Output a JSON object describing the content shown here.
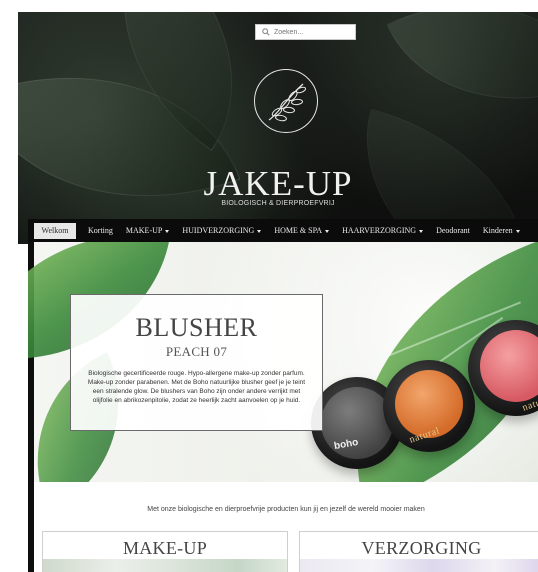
{
  "header": {
    "search": {
      "placeholder": "Zoeken..."
    },
    "brand": {
      "name": "JAKE-UP",
      "tagline": "BIOLOGISCH & DIERPROEFVRIJ"
    }
  },
  "nav": {
    "items": [
      {
        "label": "Welkom",
        "active": true,
        "has_dropdown": false
      },
      {
        "label": "Korting",
        "active": false,
        "has_dropdown": false
      },
      {
        "label": "MAKE-UP",
        "active": false,
        "has_dropdown": true
      },
      {
        "label": "HUIDVERZORGING",
        "active": false,
        "has_dropdown": true
      },
      {
        "label": "HOME & SPA",
        "active": false,
        "has_dropdown": true
      },
      {
        "label": "HAARVERZORGING",
        "active": false,
        "has_dropdown": true
      },
      {
        "label": "Deodorant",
        "active": false,
        "has_dropdown": false
      },
      {
        "label": "Kinderen",
        "active": false,
        "has_dropdown": true
      }
    ]
  },
  "banner": {
    "title": "BLUSHER",
    "subtitle": "PEACH 07",
    "description": "Biologische gecertificeerde rouge. Hypo-allergene make-up zonder parfum. Make-up zonder parabenen. Met de Boho natuurlijke blusher geef je je teint een stralende glow. De blushers van Boho zijn onder andere verrijkt met olijfolie en abrikozenpitolie, zodat ze heerlijk zacht aanvoelen op je huid.",
    "brand_marks": [
      "boho",
      "natural",
      "natural"
    ]
  },
  "main": {
    "tagline": "Met onze biologische en dierproefvrije producten kun jij en jezelf de wereld mooier maken",
    "categories": [
      {
        "label": "MAKE-UP"
      },
      {
        "label": "VERZORGING"
      }
    ]
  },
  "colors": {
    "nav_bg": "#0b0b0b",
    "nav_text": "#eaeaea",
    "active_tab_bg": "#e7e7e7",
    "accent_leaf": "#3b8a3b"
  }
}
